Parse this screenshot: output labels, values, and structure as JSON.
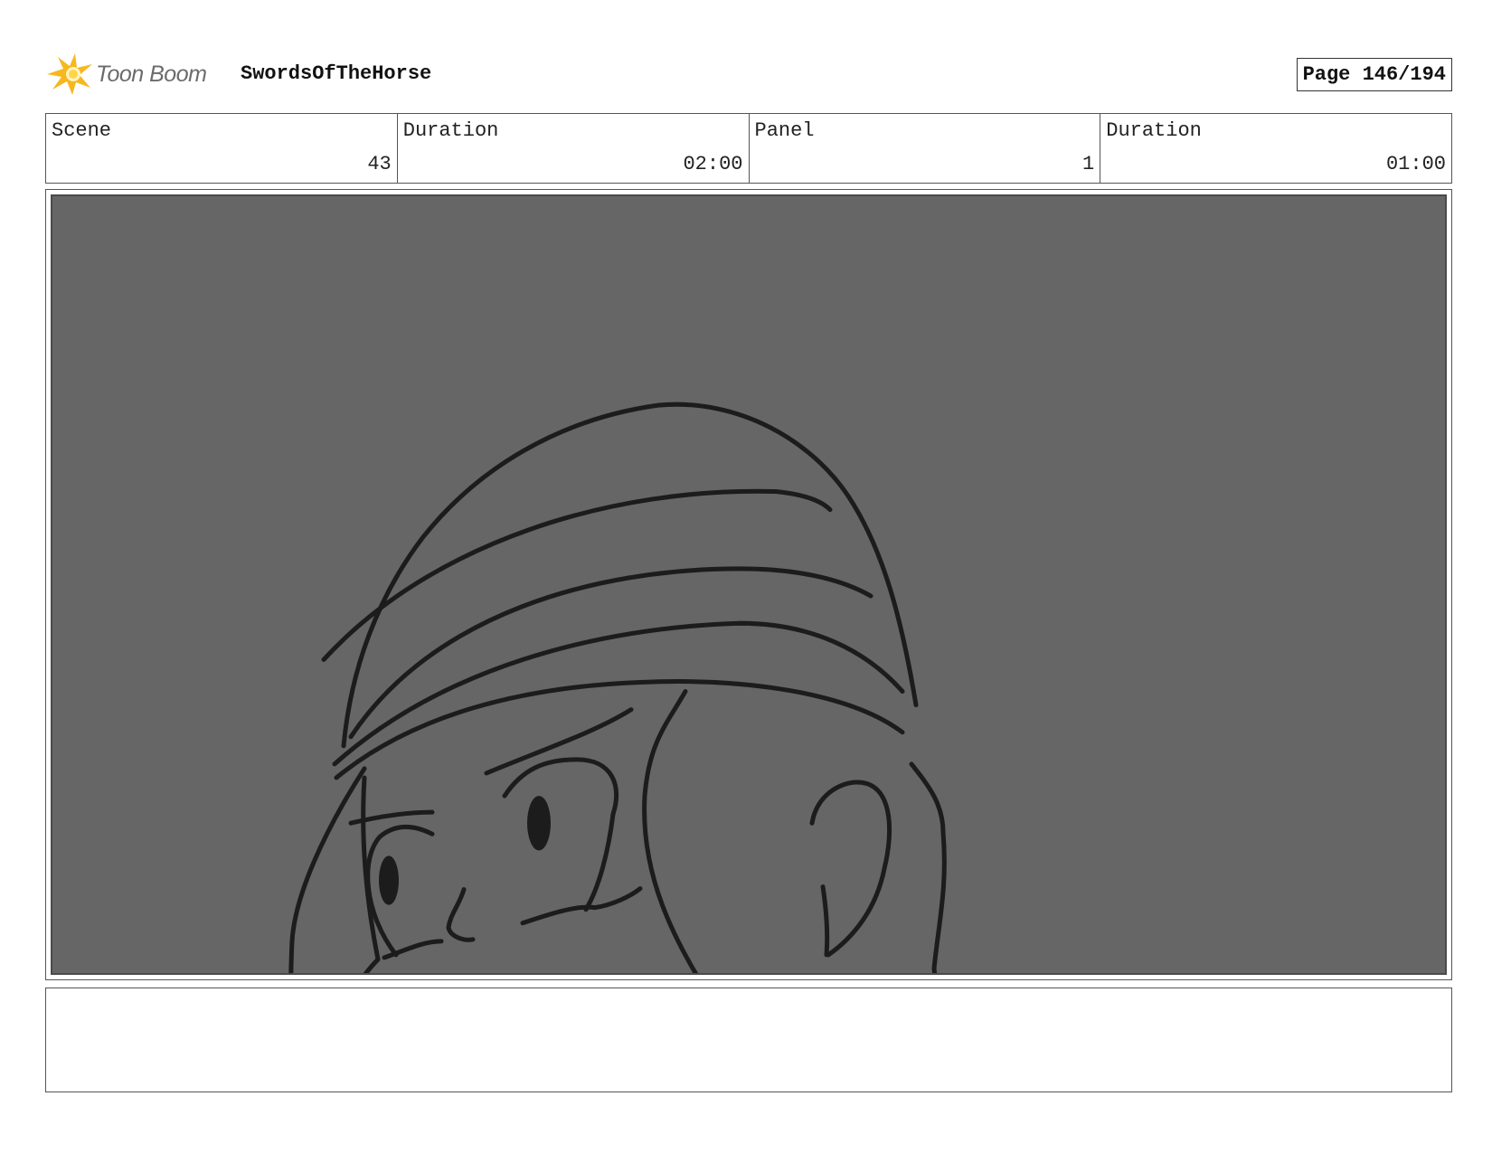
{
  "header": {
    "logo_text": "Toon Boom",
    "project_title": "SwordsOfTheHorse",
    "page_label": "Page 146/194"
  },
  "info": {
    "scene_label": "Scene",
    "scene_value": "43",
    "scene_duration_label": "Duration",
    "scene_duration_value": "02:00",
    "panel_label": "Panel",
    "panel_value": "1",
    "panel_duration_label": "Duration",
    "panel_duration_value": "01:00"
  },
  "panel": {
    "background_color": "#666666",
    "line_color": "#1c1c1c"
  },
  "notes": {
    "text": ""
  },
  "icons": {
    "logo": "toon-boom-logo-icon"
  }
}
